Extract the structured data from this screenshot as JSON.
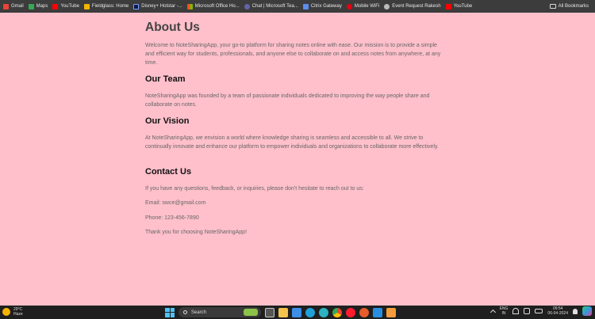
{
  "bookmarks": [
    {
      "label": "Gmail",
      "icon": "gmail-icon",
      "color": "#ea4335"
    },
    {
      "label": "Maps",
      "icon": "maps-icon",
      "color": "#34a853"
    },
    {
      "label": "YouTube",
      "icon": "youtube-icon",
      "color": "#ff0000"
    },
    {
      "label": "Fieldglass: Home",
      "icon": "fieldglass-icon",
      "color": "#f4b400"
    },
    {
      "label": "Disney+ Hotstar -...",
      "icon": "hotstar-icon",
      "color": "#0c1a4b"
    },
    {
      "label": "Microsoft Office Ho...",
      "icon": "office-icon",
      "color": "#d83b01"
    },
    {
      "label": "Chat | Microsoft Tea...",
      "icon": "teams-icon",
      "color": "#6264a7"
    },
    {
      "label": "Citrix Gateway",
      "icon": "citrix-icon",
      "color": "#5b8def"
    },
    {
      "label": "Mobile WiFi",
      "icon": "huawei-icon",
      "color": "#e60012"
    },
    {
      "label": "Event Request Rakesh",
      "icon": "globe-icon",
      "color": "#bbbbbb"
    },
    {
      "label": "YouTube",
      "icon": "youtube-icon",
      "color": "#ff0000"
    }
  ],
  "all_bookmarks": "All Bookmarks",
  "page": {
    "title": "About Us",
    "intro": "Welcome to NoteSharingApp, your go-to platform for sharing notes online with ease. Our mission is to provide a simple and efficient way for students, professionals, and anyone else to collaborate on and access notes from anywhere, at any time.",
    "team_heading": "Our Team",
    "team_text": "NoteSharingApp was founded by a team of passionate individuals dedicated to improving the way people share and collaborate on notes.",
    "vision_heading": "Our Vision",
    "vision_text": "At NoteSharingApp, we envision a world where knowledge sharing is seamless and accessible to all. We strive to continually innovate and enhance our platform to empower individuals and organizations to collaborate more effectively.",
    "contact_heading": "Contact Us",
    "contact_text": "If you have any questions, feedback, or inquiries, please don't hesitate to reach out to us:",
    "email": "Email: swce@gmail.com",
    "phone": "Phone: 123-456-7890",
    "thanks": "Thank you for choosing NoteSharingApp!"
  },
  "taskbar": {
    "weather_temp": "29°C",
    "weather_desc": "Haze",
    "search_placeholder": "Search",
    "lang_1": "ENG",
    "lang_2": "IN",
    "time": "09:54",
    "date": "06-04-2024"
  },
  "colors": {
    "page_background": "#ffc0cb",
    "bookmark_bar": "#3c3c3c",
    "taskbar": "#1f1f1f"
  }
}
